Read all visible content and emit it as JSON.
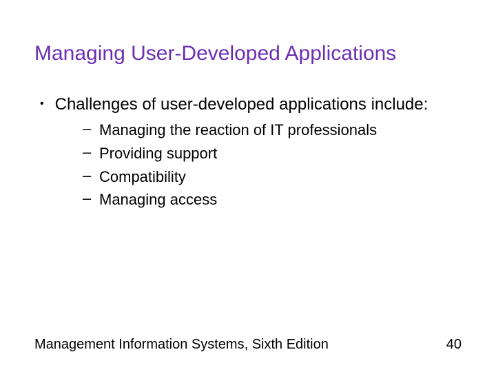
{
  "title": "Managing User-Developed Applications",
  "bullet": {
    "text": "Challenges of user-developed applications include:"
  },
  "subitems": {
    "0": "Managing the reaction of IT professionals",
    "1": "Providing support",
    "2": "Compatibility",
    "3": "Managing access"
  },
  "footer": {
    "text": "Management Information Systems, Sixth Edition",
    "page": "40"
  }
}
